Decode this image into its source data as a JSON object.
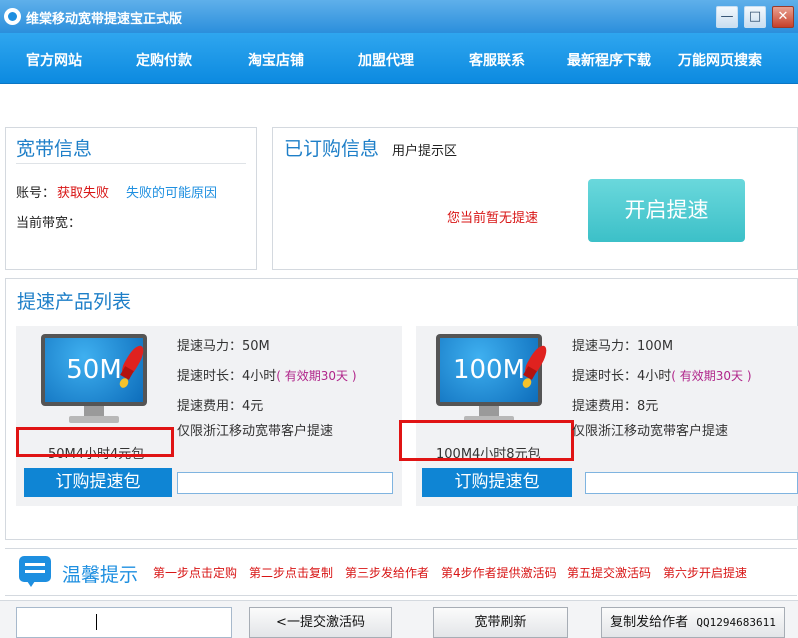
{
  "window": {
    "title": "维棠移动宽带提速宝正式版",
    "minimize_icon": "minimize-icon",
    "maximize_icon": "maximize-icon",
    "close_icon": "close-icon"
  },
  "nav": [
    "官方网站",
    "定购付款",
    "淘宝店铺",
    "加盟代理",
    "客服联系",
    "最新程序下载",
    "万能网页搜索"
  ],
  "broadband": {
    "heading": "宽带信息",
    "account_label": "账号：",
    "account_status": "获取失败",
    "failure_link": "失败的可能原因",
    "bandwidth_label": "当前带宽："
  },
  "subscription": {
    "heading": "已订购信息",
    "hint": "用户提示区",
    "message": "您当前暂无提速",
    "start_button": "开启提速"
  },
  "products": {
    "heading": "提速产品列表",
    "items": [
      {
        "screen_text": "50M",
        "package_label": "50M4小时4元包",
        "power": "提速马力：50M",
        "duration": "提速时长：4小时",
        "validity": "( 有效期30天 )",
        "fee": "提速费用：4元",
        "restriction": "仅限浙江移动宽带客户提速",
        "order_button": "订购提速包"
      },
      {
        "screen_text": "100M",
        "package_label": "100M4小时8元包",
        "power": "提速马力：100M",
        "duration": "提速时长：4小时",
        "validity": "( 有效期30天 )",
        "fee": "提速费用：8元",
        "restriction": "仅限浙江移动宽带客户提速",
        "order_button": "订购提速包"
      }
    ]
  },
  "tips": {
    "title": "温馨提示",
    "steps": [
      "第一步点击定购",
      "第二步点击复制",
      "第三步发给作者",
      "第4步作者提供激活码",
      "第五提交激活码",
      "第六步开启提速"
    ]
  },
  "bottom": {
    "input_value": "",
    "submit_button": "<一提交激活码",
    "refresh_button": "宽带刷新",
    "copy_button": "复制发给作者",
    "qq": "QQ1294683611"
  },
  "colors": {
    "nav_blue": "#0c8ae0",
    "heading_blue": "#1e7fc8",
    "alert_red": "#d81515",
    "start_button_teal": "#4cc8d0"
  }
}
